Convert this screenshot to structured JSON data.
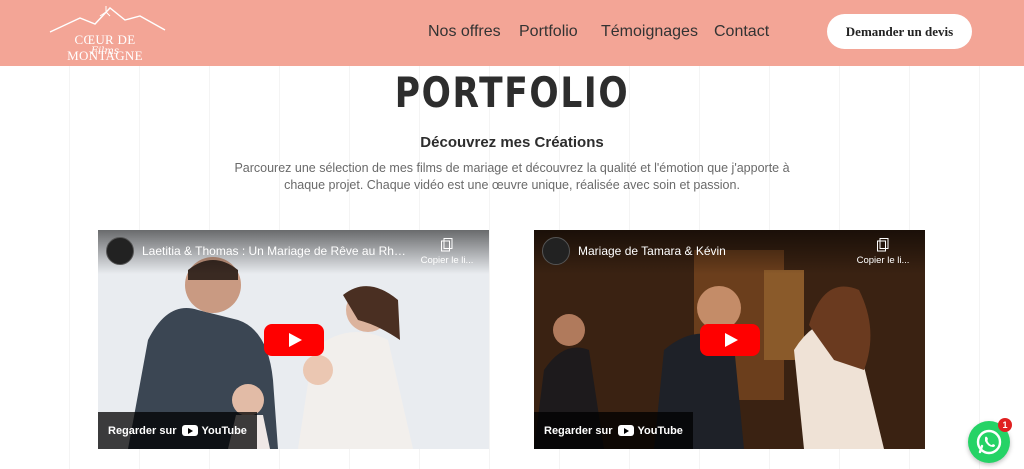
{
  "brand": {
    "name": "CŒUR DE MONTAGNE",
    "sub": "Films",
    "color": "#f3a596"
  },
  "nav": {
    "items": [
      {
        "label": "Nos offres"
      },
      {
        "label": "Portfolio"
      },
      {
        "label": "Témoignages"
      },
      {
        "label": "Contact"
      }
    ],
    "cta_label": "Demander un devis"
  },
  "main": {
    "title": "PORTFOLIO",
    "subtitle": "Découvrez mes Créations",
    "description": "Parcourez une sélection de mes films de mariage et découvrez la qualité et l'émotion que j'apporte à chaque projet. Chaque vidéo est une œuvre unique, réalisée avec soin et passion."
  },
  "videos": [
    {
      "title": "Laetitia & Thomas : Un Mariage de Rêve au Rhône...",
      "copy_label": "Copier le li...",
      "watch_label": "Regarder sur",
      "platform": "YouTube"
    },
    {
      "title": "Mariage de Tamara & Kévin",
      "copy_label": "Copier le li...",
      "watch_label": "Regarder sur",
      "platform": "YouTube"
    }
  ],
  "whatsapp": {
    "badge": "1",
    "color": "#25d366"
  }
}
